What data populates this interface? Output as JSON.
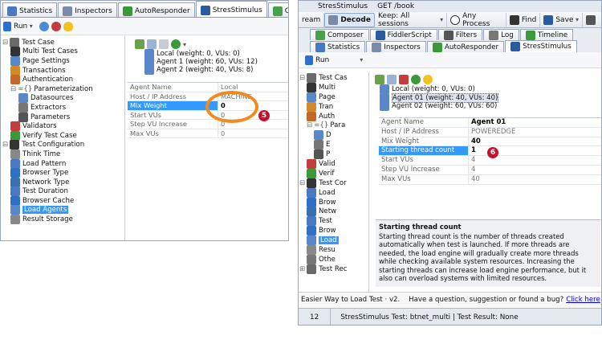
{
  "left": {
    "tabs": [
      {
        "label": "Statistics",
        "icon": "stopwatch-icon",
        "color": "#4a78c2"
      },
      {
        "label": "Inspectors",
        "icon": "inspector-grid-icon",
        "color": "#7a8aa8"
      },
      {
        "label": "AutoResponder",
        "icon": "lightning-icon",
        "color": "#3a9a3a"
      },
      {
        "label": "StresStimulus",
        "icon": "stopwatch-icon",
        "color": "#2c5aa0",
        "active": true
      },
      {
        "label": "Composer",
        "icon": "composer-icon",
        "color": "#4aa04a"
      }
    ],
    "toolbar": {
      "run_label": "Run"
    },
    "tree": [
      {
        "label": "Test Case",
        "level": 0,
        "expander": "minus",
        "icon": "folder-icon",
        "color": "#6a6a6a"
      },
      {
        "label": "Multi Test Cases",
        "level": 1,
        "icon": "cases-icon",
        "color": "#333333"
      },
      {
        "label": "Page Settings",
        "level": 1,
        "icon": "page-icon",
        "color": "#5a87c9"
      },
      {
        "label": "Transactions",
        "level": 1,
        "icon": "users-icon",
        "color": "#d08a2a"
      },
      {
        "label": "Authentication",
        "level": 1,
        "icon": "user-icon",
        "color": "#c4682a"
      },
      {
        "label": "Parameterization",
        "level": 1,
        "expander": "minus",
        "prefix": "={}",
        "color": "#555555"
      },
      {
        "label": "Datasources",
        "level": 2,
        "icon": "table-icon",
        "color": "#5a87c9"
      },
      {
        "label": "Extractors",
        "level": 2,
        "icon": "pen-icon",
        "color": "#777777"
      },
      {
        "label": "Parameters",
        "level": 2,
        "icon": "p-icon",
        "color": "#555555"
      },
      {
        "label": "Validators",
        "level": 1,
        "icon": "validator-icon",
        "color": "#c43c3c"
      },
      {
        "label": "Verify Test Case",
        "level": 1,
        "icon": "check-icon",
        "color": "#3a9a3a"
      },
      {
        "label": "Test Configuration",
        "level": 0,
        "expander": "minus",
        "icon": "wrench-icon",
        "color": "#333333"
      },
      {
        "label": "Think Time",
        "level": 1,
        "icon": "hourglass-icon",
        "color": "#888888"
      },
      {
        "label": "Load Pattern",
        "level": 1,
        "icon": "users-icon",
        "color": "#4a78c2"
      },
      {
        "label": "Browser Type",
        "level": 1,
        "icon": "globe-icon",
        "color": "#2f6fc4"
      },
      {
        "label": "Network Type",
        "level": 1,
        "icon": "network-icon",
        "color": "#3a6fb0"
      },
      {
        "label": "Test Duration",
        "level": 1,
        "icon": "clock-icon",
        "color": "#4a78c2"
      },
      {
        "label": "Browser Cache",
        "level": 1,
        "icon": "globe-icon",
        "color": "#2f6fc4"
      },
      {
        "label": "Load Agents",
        "level": 1,
        "icon": "servers-icon",
        "color": "#5a87c9",
        "selected": true
      },
      {
        "label": "Result Storage",
        "level": 1,
        "icon": "storage-icon",
        "color": "#888888"
      }
    ],
    "agents": [
      {
        "label": "Local (weight: 0, VUs: 0)"
      },
      {
        "label": "Agent 1 (weight: 60, VUs: 12)"
      },
      {
        "label": "Agent 2 (weight: 40, VUs: 8)"
      }
    ],
    "props": [
      {
        "key": "Agent Name",
        "value": "Local"
      },
      {
        "key": "Host / IP Address",
        "value": "MACHINE"
      },
      {
        "key": "Mix Weight",
        "value": "0",
        "selected": true,
        "bold": true
      },
      {
        "key": "Start VUs",
        "value": "0"
      },
      {
        "key": "Step VU Increase",
        "value": "0"
      },
      {
        "key": "Max VUs",
        "value": "0"
      }
    ],
    "badge": "5"
  },
  "right": {
    "crumbs": [
      "StresStimulus",
      "GET /book"
    ],
    "topbar": {
      "stream": "ream",
      "decode": "Decode",
      "keep": "Keep: All sessions",
      "process": "Any Process",
      "find": "Find",
      "save": "Save"
    },
    "tabs_row1": [
      {
        "label": "Composer",
        "icon": "composer-icon",
        "color": "#4aa04a"
      },
      {
        "label": "FiddlerScript",
        "icon": "script-icon",
        "color": "#2c5aa0"
      },
      {
        "label": "Filters",
        "icon": "checkbox-icon",
        "color": "#555555"
      },
      {
        "label": "Log",
        "icon": "log-icon",
        "color": "#777777"
      },
      {
        "label": "Timeline",
        "icon": "timeline-icon",
        "color": "#3a9a3a"
      }
    ],
    "tabs_row2": [
      {
        "label": "Statistics",
        "icon": "stopwatch-icon",
        "color": "#4a78c2"
      },
      {
        "label": "Inspectors",
        "icon": "inspector-grid-icon",
        "color": "#7a8aa8"
      },
      {
        "label": "AutoResponder",
        "icon": "lightning-icon",
        "color": "#3a9a3a"
      },
      {
        "label": "StresStimulus",
        "icon": "stopwatch-icon",
        "color": "#2c5aa0",
        "active": true
      }
    ],
    "toolbar": {
      "run_label": "Run"
    },
    "tree": [
      {
        "label": "Test Cas",
        "level": 0,
        "expander": "minus",
        "icon": "folder-icon",
        "color": "#6a6a6a"
      },
      {
        "label": "Multi",
        "level": 1,
        "icon": "cases-icon",
        "color": "#333333"
      },
      {
        "label": "Page",
        "level": 1,
        "icon": "page-icon",
        "color": "#5a87c9"
      },
      {
        "label": "Tran",
        "level": 1,
        "icon": "users-icon",
        "color": "#d08a2a"
      },
      {
        "label": "Auth",
        "level": 1,
        "icon": "user-icon",
        "color": "#c4682a"
      },
      {
        "label": "Para",
        "level": 1,
        "expander": "minus",
        "prefix": "={}",
        "color": "#555555"
      },
      {
        "label": "D",
        "level": 2,
        "icon": "table-icon",
        "color": "#5a87c9"
      },
      {
        "label": "E",
        "level": 2,
        "icon": "pen-icon",
        "color": "#777777"
      },
      {
        "label": "P",
        "level": 2,
        "icon": "p-icon",
        "color": "#555555"
      },
      {
        "label": "Valid",
        "level": 1,
        "icon": "validator-icon",
        "color": "#c43c3c"
      },
      {
        "label": "Verif",
        "level": 1,
        "icon": "check-icon",
        "color": "#3a9a3a"
      },
      {
        "label": "Test Cor",
        "level": 0,
        "expander": "minus",
        "icon": "wrench-icon",
        "color": "#333333"
      },
      {
        "label": "Load",
        "level": 1,
        "icon": "users-icon",
        "color": "#4a78c2"
      },
      {
        "label": "Brow",
        "level": 1,
        "icon": "globe-icon",
        "color": "#2f6fc4"
      },
      {
        "label": "Netw",
        "level": 1,
        "icon": "network-icon",
        "color": "#3a6fb0"
      },
      {
        "label": "Test",
        "level": 1,
        "icon": "clock-icon",
        "color": "#4a78c2"
      },
      {
        "label": "Brow",
        "level": 1,
        "icon": "globe-icon",
        "color": "#2f6fc4"
      },
      {
        "label": "Load",
        "level": 1,
        "icon": "servers-icon",
        "color": "#5a87c9",
        "selected": true
      },
      {
        "label": "Resu",
        "level": 1,
        "icon": "storage-icon",
        "color": "#888888"
      },
      {
        "label": "Othe",
        "level": 1,
        "icon": "wrench-icon",
        "color": "#777777"
      },
      {
        "label": "Test Rec",
        "level": 0,
        "expander": "plus",
        "icon": "folder-icon",
        "color": "#6a6a6a"
      }
    ],
    "agents": [
      {
        "label": "Local (weight: 0, VUs: 0)"
      },
      {
        "label": "Agent 01 (weight: 40, VUs: 40)",
        "selected": true
      },
      {
        "label": "Agent 02 (weight: 60, VUs: 60)"
      }
    ],
    "props": [
      {
        "key": "Agent Name",
        "value": "Agent 01",
        "head": true
      },
      {
        "key": "Host / IP Address",
        "value": "POWEREDGE"
      },
      {
        "key": "Mix Weight",
        "value": "40",
        "bold": true
      },
      {
        "key": "Starting thread count",
        "value": "1",
        "selected": true,
        "bold": true
      },
      {
        "key": "Start VUs",
        "value": "4"
      },
      {
        "key": "Step VU Increase",
        "value": "4"
      },
      {
        "key": "Max VUs",
        "value": "40"
      }
    ],
    "badge": "6",
    "description": {
      "title": "Starting thread count",
      "body": "Starting thread count is the number of threads created automatically when test is launched. If more threads are needed, the load engine will gradually create more threads while checking available system resources. Increasing the starting threads can increase load engine performance, but it also can overload systems with limited resources."
    },
    "footer": {
      "text": "Easier Way to Load Test · v2.    Have a question, suggestion or found a bug?",
      "link": "Click here"
    },
    "status": {
      "count": "12",
      "text": "StresStimulus Test: btnet_multi | Test Result: None"
    }
  },
  "colors": {
    "selection": "#3399ff",
    "callout_oval": "#f28a1e",
    "badge": "#c8102e",
    "link": "#0000ee"
  }
}
